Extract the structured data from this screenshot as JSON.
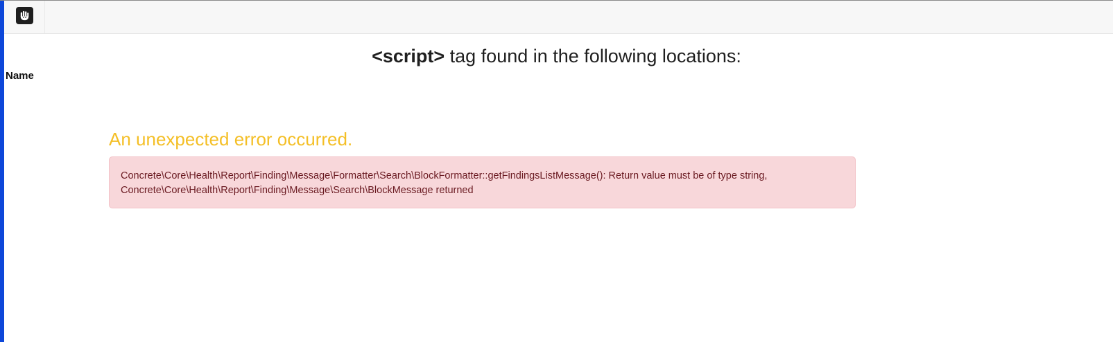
{
  "toolbar": {
    "logo_icon": "concrete-cms-hand-icon"
  },
  "heading": {
    "tag": "<script>",
    "rest": " tag found in the following locations:"
  },
  "table": {
    "header_name": "Name"
  },
  "error": {
    "title": "An unexpected error occurred.",
    "message_line1": "Concrete\\Core\\Health\\Report\\Finding\\Message\\Formatter\\Search\\BlockFormatter::getFindingsListMessage(): Return value must be of type string,",
    "message_line2": "Concrete\\Core\\Health\\Report\\Finding\\Message\\Search\\BlockMessage returned"
  },
  "colors": {
    "accent_blue": "#0d47d9",
    "warning_title": "#f4bf26",
    "alert_bg": "#f8d7da",
    "alert_text": "#6a1a21"
  }
}
